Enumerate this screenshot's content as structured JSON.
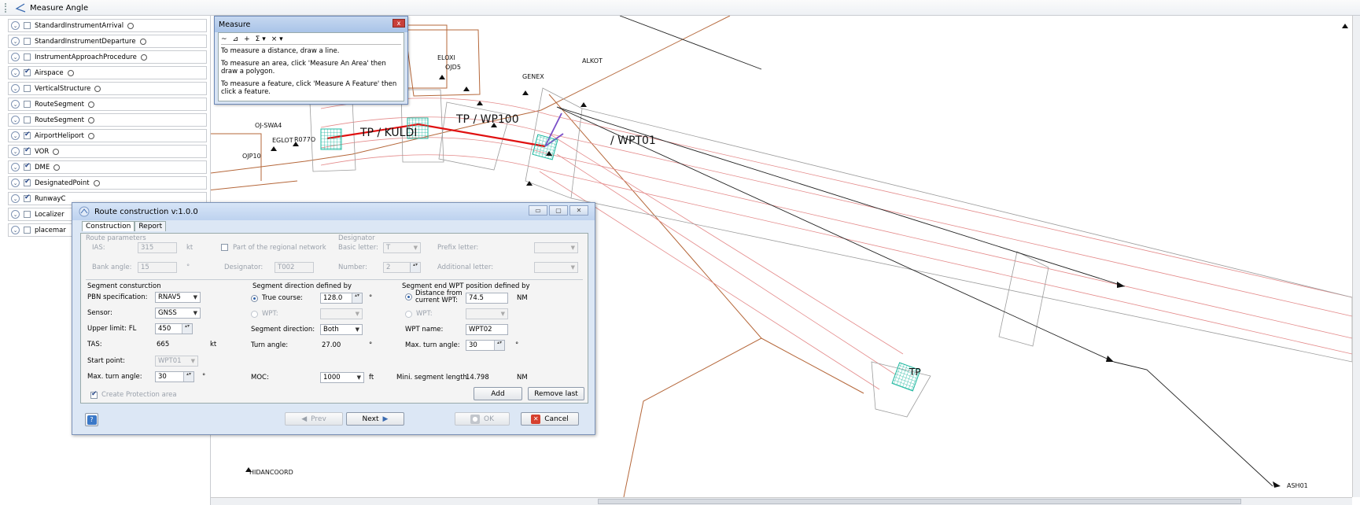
{
  "toolbar": {
    "measure_angle_label": "Measure Angle",
    "tool_icon": "angle-icon"
  },
  "layers": [
    {
      "name": "StandardInstrumentArrival",
      "checked": false
    },
    {
      "name": "StandardInstrumentDeparture",
      "checked": false
    },
    {
      "name": "InstrumentApproachProcedure",
      "checked": false
    },
    {
      "name": "Airspace",
      "checked": true
    },
    {
      "name": "VerticalStructure",
      "checked": false
    },
    {
      "name": "RouteSegment",
      "checked": false
    },
    {
      "name": "RouteSegment",
      "checked": false
    },
    {
      "name": "AirportHeliport",
      "checked": true
    },
    {
      "name": "VOR",
      "checked": true
    },
    {
      "name": "DME",
      "checked": true
    },
    {
      "name": "DesignatedPoint",
      "checked": true
    },
    {
      "name": "RunwayC",
      "checked": true
    },
    {
      "name": "Localizer",
      "checked": false
    },
    {
      "name": "placemar",
      "checked": false
    }
  ],
  "measure": {
    "title": "Measure",
    "close": "x",
    "toolbar_symbols": [
      "~",
      "⊿",
      "+",
      "Σ ▾",
      "× ▾"
    ],
    "line1": "To measure a distance, draw a line.",
    "line2": "To measure an area, click 'Measure An Area' then draw a polygon.",
    "line3": "To measure a feature, click 'Measure A Feature' then click a feature."
  },
  "map": {
    "labels": {
      "eloxi": "ELOXI",
      "ojd5": "OJD5",
      "alkot": "ALKOT",
      "genex": "GENEX",
      "ojswa4": "OJ-SWA4",
      "eglot": "EGLOT",
      "r077o": "R077O",
      "ojp10": "OJP10",
      "hidancoord": "HIDANCOORD",
      "ash01": "ASH01"
    },
    "tp_kuldi": "TP / KULDI",
    "tp_wp100": "TP / WP100",
    "tp_wpt01": "/ WPT01",
    "tp_last": "TP"
  },
  "dialog": {
    "title": "Route construction v:1.0.0",
    "tabs": [
      "Construction",
      "Report"
    ],
    "route_parameters": "Route parameters",
    "ias_label": "IAS:",
    "ias_value": "315",
    "ias_unit": "kt",
    "bank_label": "Bank angle:",
    "bank_value": "15",
    "bank_unit": "°",
    "regional_label": "Part of the regional network",
    "designator_label": "Designator:",
    "designator_value": "T002",
    "designator_group": "Designator",
    "basic_letter_label": "Basic letter:",
    "basic_letter_value": "T",
    "prefix_letter_label": "Prefix letter:",
    "prefix_letter_value": "",
    "number_label": "Number:",
    "number_value": "2",
    "additional_letter_label": "Additional letter:",
    "additional_letter_value": "",
    "segment_construction": "Segment consturction",
    "pbn_label": "PBN specification:",
    "pbn_value": "RNAV5",
    "sensor_label": "Sensor:",
    "sensor_value": "GNSS",
    "upper_label": "Upper limit: FL",
    "upper_value": "450",
    "tas_label": "TAS:",
    "tas_value": "665",
    "tas_unit": "kt",
    "start_label": "Start point:",
    "start_value": "WPT01",
    "max_turn_label": "Max. turn angle:",
    "max_turn_value": "30",
    "max_turn_unit": "°",
    "create_protection": "Create Protection area",
    "direction_group": "Segment direction defined by",
    "true_course_label": "True course:",
    "true_course_value": "128.0",
    "true_course_unit": "°",
    "wpt_label": "WPT:",
    "wpt_value": "",
    "seg_direction_label": "Segment direction:",
    "seg_direction_value": "Both",
    "turn_angle_label": "Turn angle:",
    "turn_angle_value": "27.00",
    "turn_angle_unit": "°",
    "moc_label": "MOC:",
    "moc_value": "1000",
    "moc_unit": "ft",
    "end_group": "Segment end WPT position defined by",
    "distance_label": "Distance from current WPT:",
    "distance_value": "74.5",
    "distance_unit": "NM",
    "end_wpt_label": "WPT:",
    "end_wpt_value": "",
    "wpt_name_label": "WPT name:",
    "wpt_name_value": "WPT02",
    "end_max_turn_label": "Max. turn angle:",
    "end_max_turn_value": "30",
    "end_max_turn_unit": "°",
    "mini_seg_label": "Mini. segment length",
    "mini_seg_value": "14.798",
    "mini_seg_unit": "NM",
    "add_label": "Add",
    "remove_last_label": "Remove last",
    "prev_label": "Prev",
    "next_label": "Next",
    "ok_label": "OK",
    "cancel_label": "Cancel"
  }
}
